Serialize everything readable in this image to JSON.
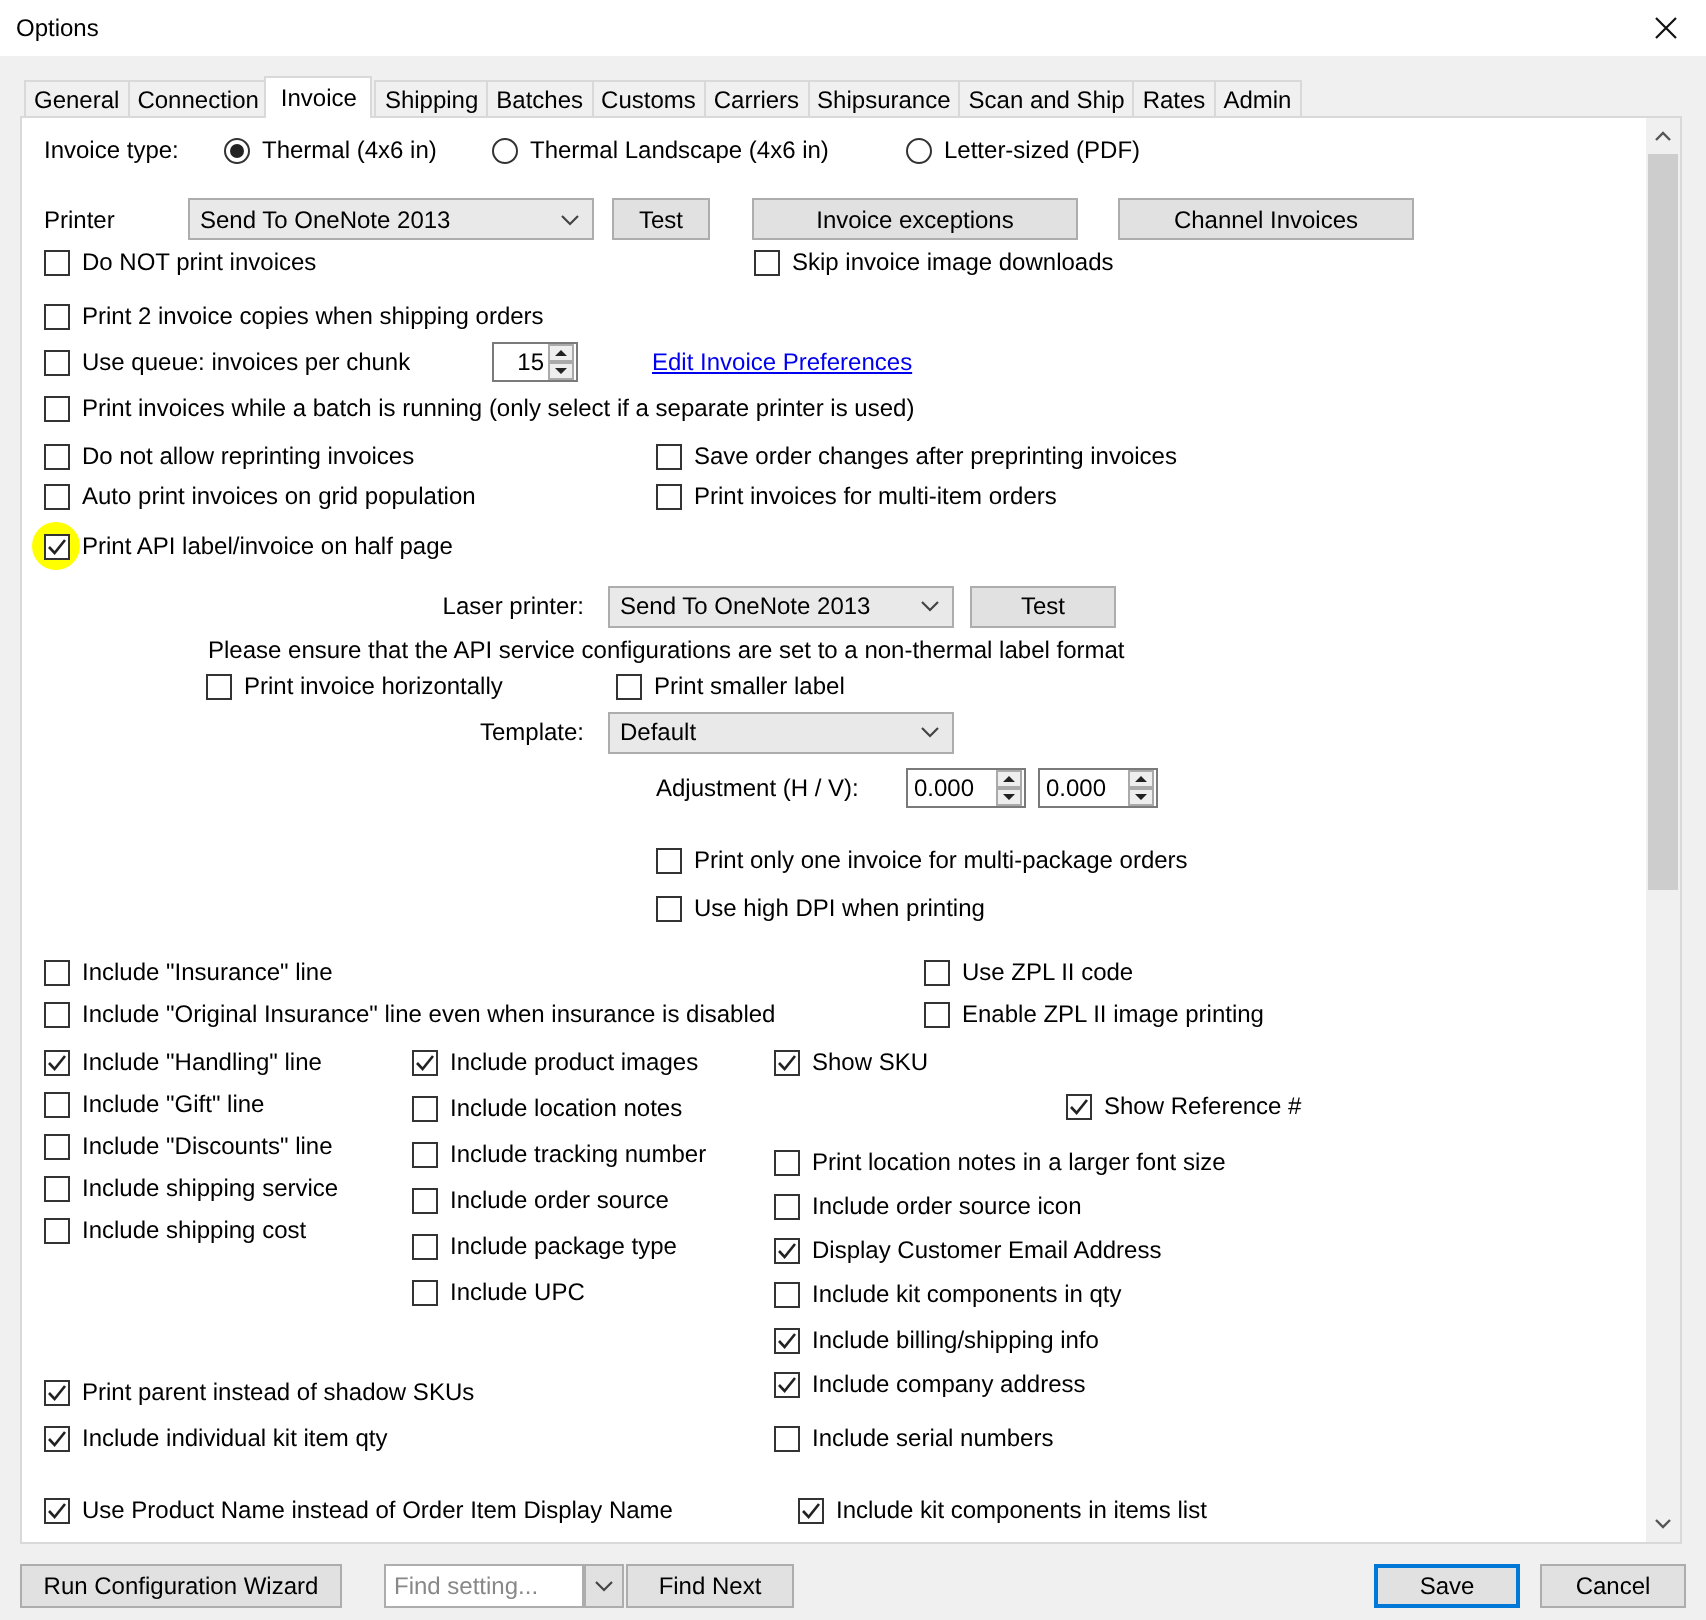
{
  "window": {
    "title": "Options"
  },
  "tabs": [
    {
      "label": "General",
      "selected": false
    },
    {
      "label": "Connection",
      "selected": false
    },
    {
      "label": "Invoice",
      "selected": true
    },
    {
      "label": "Shipping",
      "selected": false
    },
    {
      "label": "Batches",
      "selected": false
    },
    {
      "label": "Customs",
      "selected": false
    },
    {
      "label": "Carriers",
      "selected": false
    },
    {
      "label": "Shipsurance",
      "selected": false
    },
    {
      "label": "Scan and Ship",
      "selected": false
    },
    {
      "label": "Rates",
      "selected": false
    },
    {
      "label": "Admin",
      "selected": false
    }
  ],
  "invoice_type": {
    "label": "Invoice type:",
    "options": [
      {
        "label": "Thermal (4x6 in)",
        "selected": true
      },
      {
        "label": "Thermal Landscape (4x6 in)",
        "selected": false
      },
      {
        "label": "Letter-sized (PDF)",
        "selected": false
      }
    ]
  },
  "printer": {
    "label": "Printer",
    "value": "Send To OneNote 2013",
    "test": "Test",
    "buttons": [
      "Invoice exceptions",
      "Channel Invoices"
    ]
  },
  "rows": [
    {
      "kind": "pair",
      "items": [
        {
          "label": "Do NOT print invoices",
          "checked": false
        },
        {
          "label": "Skip invoice image downloads",
          "checked": false
        }
      ]
    },
    {
      "kind": "single",
      "items": [
        {
          "label": "Print 2 invoice copies when shipping orders",
          "checked": false
        }
      ]
    },
    {
      "kind": "queue",
      "items": [
        {
          "label": "Use queue: invoices per chunk",
          "checked": false
        }
      ],
      "value": "15",
      "link": "Edit Invoice Preferences"
    },
    {
      "kind": "single",
      "items": [
        {
          "label": "Print invoices while a batch is running (only select if a separate printer is used)",
          "checked": false
        }
      ]
    },
    {
      "kind": "pair",
      "items": [
        {
          "label": "Do not allow reprinting invoices",
          "checked": false
        },
        {
          "label": "Save order changes after preprinting invoices",
          "checked": false
        }
      ]
    },
    {
      "kind": "pair",
      "items": [
        {
          "label": "Auto print invoices on grid population",
          "checked": false
        },
        {
          "label": "Print invoices for multi-item orders",
          "checked": false
        }
      ]
    },
    {
      "kind": "single",
      "items": [
        {
          "label": "Print API label/invoice on half page",
          "checked": true,
          "highlighted": true
        }
      ]
    }
  ],
  "half_page": {
    "laser_label": "Laser printer:",
    "laser_value": "Send To OneNote 2013",
    "test": "Test",
    "note": "Please ensure that the API service configurations are set to a non-thermal label format",
    "checks": [
      {
        "label": "Print invoice horizontally",
        "checked": false
      },
      {
        "label": "Print smaller label",
        "checked": false
      }
    ],
    "template_label": "Template:",
    "template_value": "Default",
    "adjustment_label": "Adjustment (H / V):",
    "adjustment_values": [
      "0.000",
      "0.000"
    ],
    "extra_checks": [
      {
        "label": "Print only one invoice for multi-package orders",
        "checked": false
      },
      {
        "label": "Use high DPI when printing",
        "checked": false
      }
    ]
  },
  "zpl_rows": [
    [
      {
        "label": "Include \"Insurance\" line",
        "checked": false
      },
      {
        "label": "Use ZPL II code",
        "checked": false
      }
    ],
    [
      {
        "label": "Include \"Original Insurance\" line even when insurance is disabled",
        "checked": false
      },
      {
        "label": "Enable ZPL II image printing",
        "checked": false
      }
    ]
  ],
  "columns": [
    [
      {
        "label": "Include \"Handling\" line",
        "checked": true
      },
      {
        "label": "Include \"Gift\" line",
        "checked": false
      },
      {
        "label": "Include \"Discounts\" line",
        "checked": false
      },
      {
        "label": "Include shipping service",
        "checked": false
      },
      {
        "label": "Include shipping cost",
        "checked": false
      }
    ],
    [
      {
        "label": "Include product images",
        "checked": true
      },
      {
        "label": "Include location notes",
        "checked": false
      },
      {
        "label": "Include tracking number",
        "checked": false
      },
      {
        "label": "Include order source",
        "checked": false
      },
      {
        "label": "Include package type",
        "checked": false
      },
      {
        "label": "Include UPC",
        "checked": false
      }
    ],
    [
      {
        "label": "Show SKU",
        "checked": true
      },
      {
        "label": "Show Reference #",
        "checked": true
      },
      {
        "label": "Print location notes in a larger font size",
        "checked": false
      },
      {
        "label": "Include order source icon",
        "checked": false
      },
      {
        "label": "Display Customer Email Address",
        "checked": true
      },
      {
        "label": "Include kit components in qty",
        "checked": false
      }
    ]
  ],
  "columns_lower": [
    [
      {
        "label": "Print parent instead of shadow SKUs",
        "checked": true
      },
      {
        "label": "Include individual kit item qty",
        "checked": true
      }
    ],
    [
      {
        "label": "Include billing/shipping info",
        "checked": true
      },
      {
        "label": "Include company address",
        "checked": true
      },
      {
        "label": "Include serial numbers",
        "checked": false
      }
    ]
  ],
  "bottom_checks": [
    {
      "label": "Use Product Name instead of Order Item Display Name",
      "checked": true
    },
    {
      "label": "Include kit components in items list",
      "checked": true
    }
  ],
  "footer": {
    "wizard": "Run Configuration Wizard",
    "find_placeholder": "Find setting...",
    "find_next": "Find Next",
    "save": "Save",
    "cancel": "Cancel"
  }
}
